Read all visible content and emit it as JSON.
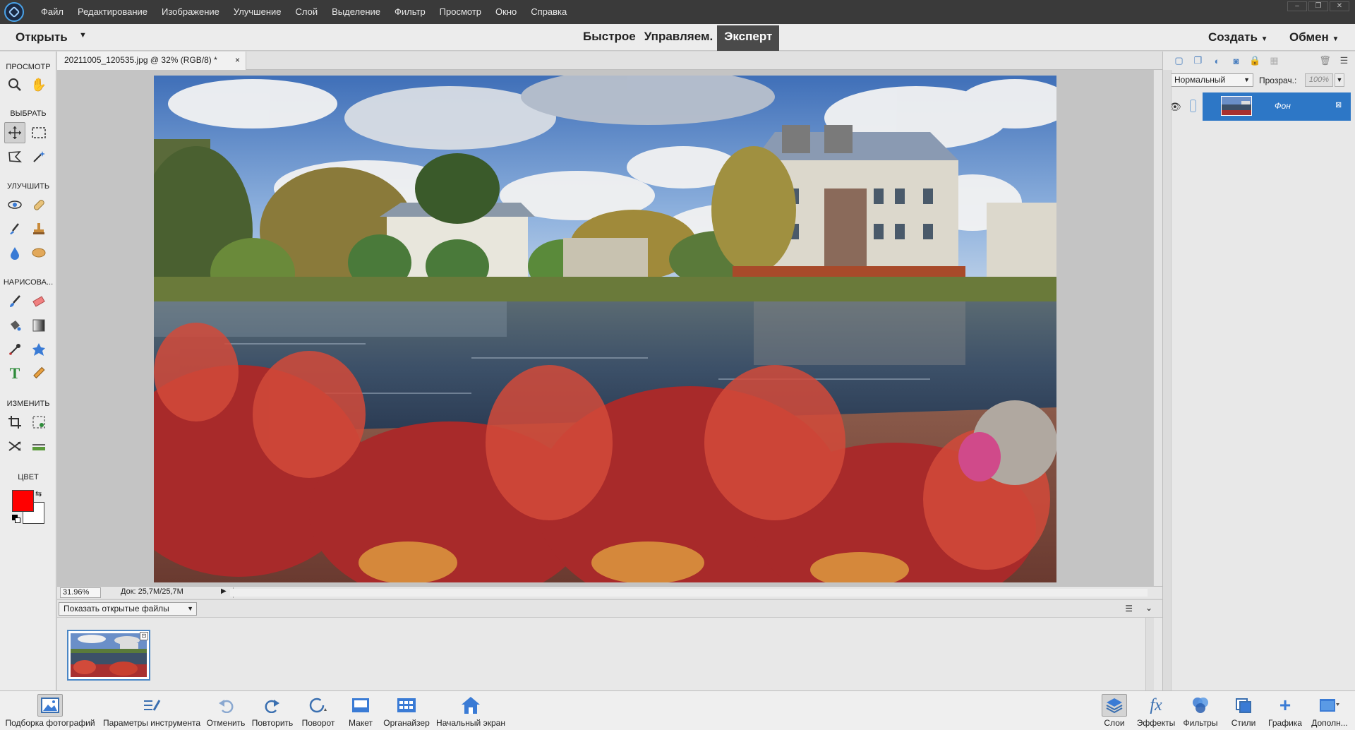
{
  "menubar": {
    "items": [
      "Файл",
      "Редактирование",
      "Изображение",
      "Улучшение",
      "Слой",
      "Выделение",
      "Фильтр",
      "Просмотр",
      "Окно",
      "Справка"
    ]
  },
  "modebar": {
    "open_label": "Открыть",
    "tabs": [
      "Быстрое",
      "Управляем.",
      "Эксперт"
    ],
    "active_tab": "Эксперт",
    "create_label": "Создать",
    "share_label": "Обмен"
  },
  "toolbox": {
    "sections": {
      "view": "ПРОСМОТР",
      "select": "ВЫБРАТЬ",
      "enhance": "УЛУЧШИТЬ",
      "draw": "НАРИСОВА...",
      "modify": "ИЗМЕНИТЬ",
      "color": "ЦВЕТ"
    },
    "foreground_color": "#ff0000",
    "background_color": "#ffffff"
  },
  "document": {
    "tab_title": "20211005_120535.jpg @ 32% (RGB/8) *",
    "close_glyph": "×"
  },
  "status": {
    "zoom": "31.96%",
    "doc_size": "Док: 25,7M/25,7M"
  },
  "photo_bin": {
    "filter_label": "Показать открытые файлы"
  },
  "layers_panel": {
    "blend_mode": "Нормальный",
    "opacity_label": "Прозрач.:",
    "opacity_value": "100%",
    "layers": [
      {
        "name": "Фон"
      }
    ]
  },
  "bottombar": {
    "items": [
      {
        "label": "Подборка фотографий",
        "icon": "photo-bin-icon",
        "active": true
      },
      {
        "label": "Параметры инструмента",
        "icon": "tool-options-icon",
        "active": false
      },
      {
        "label": "Отменить",
        "icon": "undo-icon",
        "active": false
      },
      {
        "label": "Повторить",
        "icon": "redo-icon",
        "active": false
      },
      {
        "label": "Поворот",
        "icon": "rotate-icon",
        "active": false
      },
      {
        "label": "Макет",
        "icon": "layout-icon",
        "active": false
      },
      {
        "label": "Органайзер",
        "icon": "organizer-icon",
        "active": false
      },
      {
        "label": "Начальный экран",
        "icon": "home-screen-icon",
        "active": false
      },
      {
        "label": "Слои",
        "icon": "layers-icon",
        "active": true
      },
      {
        "label": "Эффекты",
        "icon": "effects-icon",
        "active": false
      },
      {
        "label": "Фильтры",
        "icon": "filters-icon",
        "active": false
      },
      {
        "label": "Стили",
        "icon": "styles-icon",
        "active": false
      },
      {
        "label": "Графика",
        "icon": "graphics-icon",
        "active": false
      },
      {
        "label": "Дополн...",
        "icon": "more-icon",
        "active": false
      }
    ]
  }
}
